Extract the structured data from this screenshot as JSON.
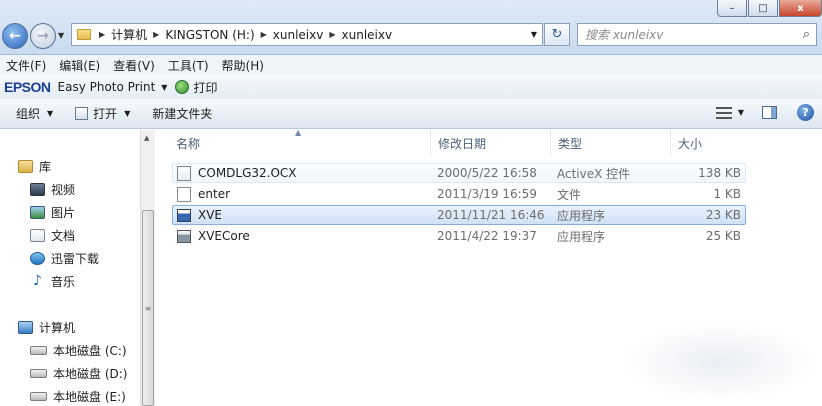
{
  "window_controls": {
    "minimize": "–",
    "maximize": "□",
    "close": "x"
  },
  "address": {
    "crumbs": [
      "计算机",
      "KINGSTON (H:)",
      "xunleixv",
      "xunleixv"
    ]
  },
  "search": {
    "placeholder": "搜索 xunleixv"
  },
  "menu": {
    "items": [
      "文件(F)",
      "编辑(E)",
      "查看(V)",
      "工具(T)",
      "帮助(H)"
    ]
  },
  "epson": {
    "logo": "EPSON",
    "label": "Easy Photo Print",
    "print": "打印"
  },
  "commands": {
    "organize": "组织",
    "open": "打开",
    "new_folder": "新建文件夹"
  },
  "nav": {
    "library": "库",
    "library_items": [
      "视频",
      "图片",
      "文档",
      "迅雷下载",
      "音乐"
    ],
    "computer": "计算机",
    "drives": [
      "本地磁盘 (C:)",
      "本地磁盘 (D:)",
      "本地磁盘 (E:)"
    ]
  },
  "columns": {
    "name": "名称",
    "modified": "修改日期",
    "type": "类型",
    "size": "大小"
  },
  "files": [
    {
      "name": "COMDLG32.OCX",
      "modified": "2000/5/22 16:58",
      "type": "ActiveX 控件",
      "size": "138 KB"
    },
    {
      "name": "enter",
      "modified": "2011/3/19 16:59",
      "type": "文件",
      "size": "1 KB"
    },
    {
      "name": "XVE",
      "modified": "2011/11/21 16:46",
      "type": "应用程序",
      "size": "23 KB"
    },
    {
      "name": "XVECore",
      "modified": "2011/4/22 19:37",
      "type": "应用程序",
      "size": "25 KB"
    }
  ]
}
